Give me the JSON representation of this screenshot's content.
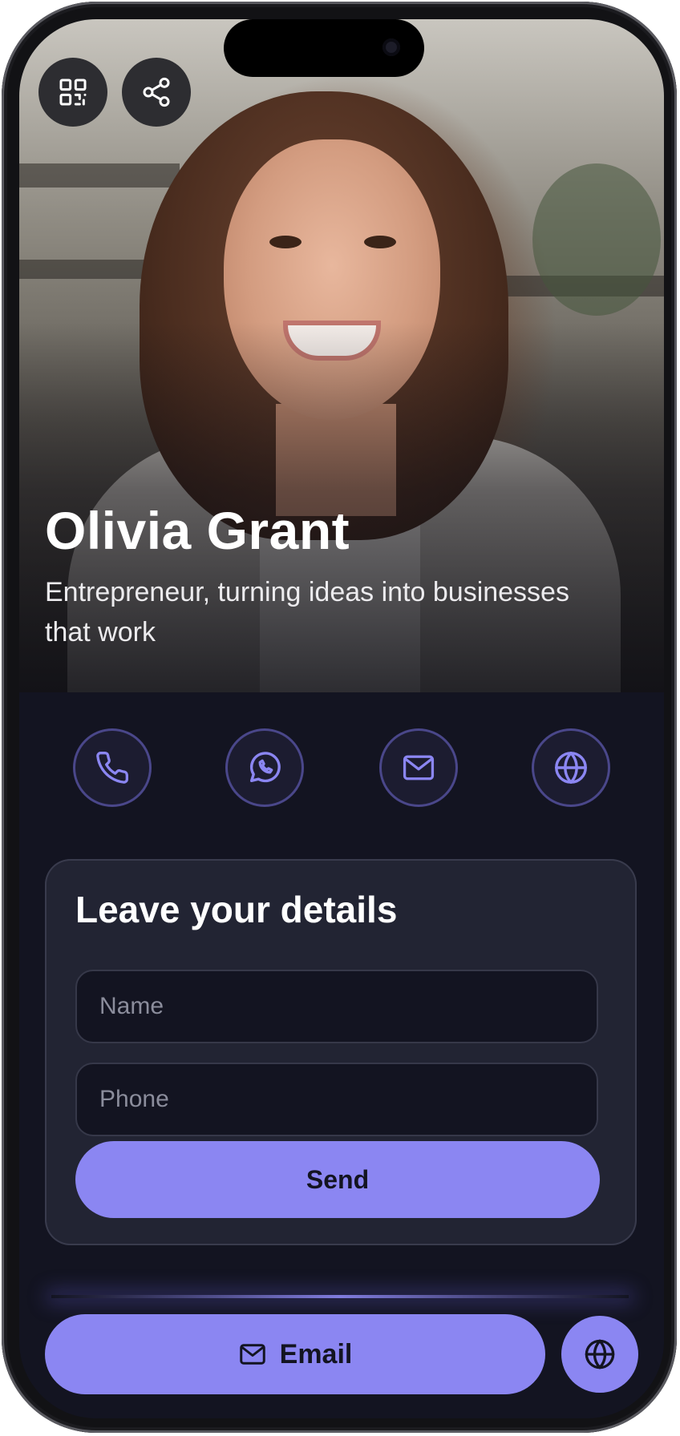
{
  "profile": {
    "name": "Olivia Grant",
    "tagline": "Entrepreneur, turning ideas into businesses that work"
  },
  "top_actions": [
    {
      "icon": "qr-code-icon"
    },
    {
      "icon": "share-icon"
    }
  ],
  "contact_actions": [
    {
      "icon": "phone-icon"
    },
    {
      "icon": "whatsapp-icon"
    },
    {
      "icon": "mail-icon"
    },
    {
      "icon": "globe-icon"
    }
  ],
  "lead_form": {
    "title": "Leave your details",
    "name_placeholder": "Name",
    "name_value": "",
    "phone_placeholder": "Phone",
    "phone_value": "",
    "submit_label": "Send"
  },
  "bottom_bar": {
    "email_label": "Email",
    "email_icon": "mail-icon",
    "website_icon": "globe-icon"
  },
  "colors": {
    "accent": "#8b86f2",
    "background": "#131421",
    "card": "#222433",
    "text": "#ffffff"
  }
}
